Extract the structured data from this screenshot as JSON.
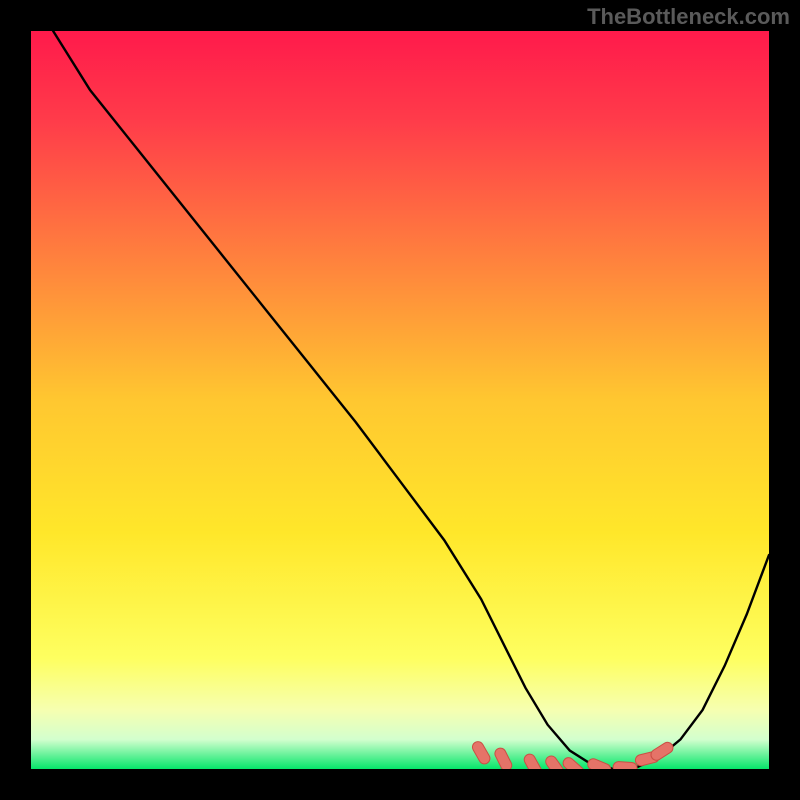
{
  "watermark": "TheBottleneck.com",
  "chart_data": {
    "type": "line",
    "title": "",
    "xlabel": "",
    "ylabel": "",
    "xlim": [
      0,
      100
    ],
    "ylim": [
      0,
      100
    ],
    "x": [
      3,
      8,
      14,
      20,
      26,
      32,
      38,
      44,
      50,
      56,
      61,
      64,
      67,
      70,
      73,
      76,
      79,
      82,
      85,
      88,
      91,
      94,
      97,
      100
    ],
    "values": [
      100,
      92,
      84.5,
      77,
      69.5,
      62,
      54.5,
      47,
      39,
      31,
      23,
      17,
      11,
      6,
      2.5,
      0.6,
      0,
      0.2,
      1.5,
      4,
      8,
      14,
      21,
      29
    ],
    "marker_points": [
      {
        "x": 61.0,
        "y": 2.2
      },
      {
        "x": 64.0,
        "y": 1.3
      },
      {
        "x": 68.0,
        "y": 0.5
      },
      {
        "x": 71.0,
        "y": 0.3
      },
      {
        "x": 73.5,
        "y": 0.2
      },
      {
        "x": 77.0,
        "y": 0.3
      },
      {
        "x": 80.5,
        "y": 0.2
      },
      {
        "x": 83.5,
        "y": 1.4
      },
      {
        "x": 85.5,
        "y": 2.4
      }
    ],
    "colors": {
      "curve": "#000000",
      "marker_fill": "#e57368",
      "marker_stroke": "#ca4f44"
    }
  }
}
